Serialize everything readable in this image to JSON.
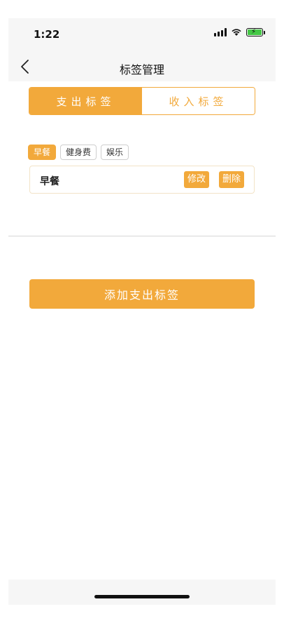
{
  "status_bar": {
    "time": "1:22"
  },
  "navbar": {
    "title": "标签管理"
  },
  "segment": {
    "expense_tab": "支出标签",
    "income_tab": "收入标签"
  },
  "tags": [
    {
      "label": "早餐",
      "active": true
    },
    {
      "label": "健身费",
      "active": false
    },
    {
      "label": "娱乐",
      "active": false
    }
  ],
  "edit_row": {
    "label": "早餐",
    "edit_button": "修改",
    "delete_button": "删除"
  },
  "add_button": {
    "label": "添加支出标签"
  },
  "colors": {
    "accent": "#f2a93b",
    "battery": "#45c746"
  },
  "icons": [
    "back-chevron-icon",
    "signal-icon",
    "wifi-icon",
    "battery-icon"
  ]
}
